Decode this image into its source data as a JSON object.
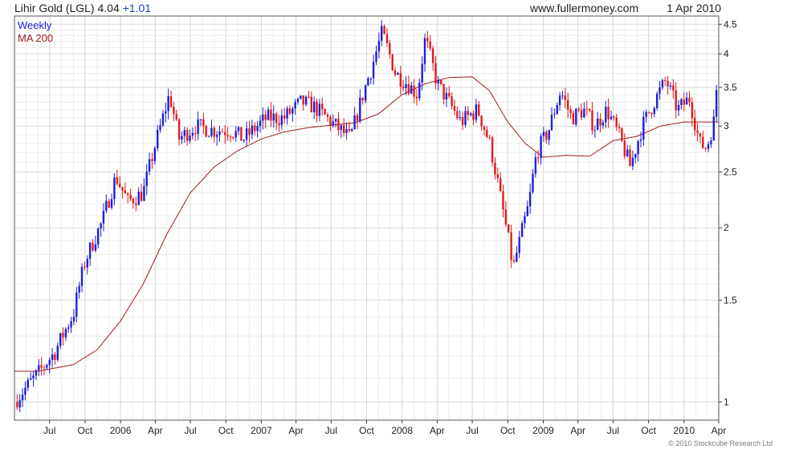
{
  "header": {
    "title": "Lihir Gold (LGL) 4.04",
    "change": "+1.01",
    "site": "www.fullermoney.com",
    "date": "1 Apr 2010"
  },
  "footer": {
    "credit": "© 2010 Stockcube Research Ltd"
  },
  "colors": {
    "up": "#1f1fd6",
    "down": "#e01b1b",
    "ma": "#a01c1c",
    "grid": "#d9d9d9",
    "legend_weekly": "#1f1fd6",
    "legend_ma": "#a01c1c"
  },
  "chart_data": {
    "type": "candlestick",
    "legend": [
      "Weekly",
      "MA 200"
    ],
    "x_axis": {
      "start": "2005-04-01",
      "end": "2010-04-01",
      "ticks": [
        {
          "label": "Jul",
          "date": "2005-07-01"
        },
        {
          "label": "Oct",
          "date": "2005-10-01"
        },
        {
          "label": "2006",
          "date": "2006-01-01"
        },
        {
          "label": "Apr",
          "date": "2006-04-01"
        },
        {
          "label": "Jul",
          "date": "2006-07-01"
        },
        {
          "label": "Oct",
          "date": "2006-10-01"
        },
        {
          "label": "2007",
          "date": "2007-01-01"
        },
        {
          "label": "Apr",
          "date": "2007-04-01"
        },
        {
          "label": "Jul",
          "date": "2007-07-01"
        },
        {
          "label": "Oct",
          "date": "2007-10-01"
        },
        {
          "label": "2008",
          "date": "2008-01-01"
        },
        {
          "label": "Apr",
          "date": "2008-04-01"
        },
        {
          "label": "Jul",
          "date": "2008-07-01"
        },
        {
          "label": "Oct",
          "date": "2008-10-01"
        },
        {
          "label": "2009",
          "date": "2009-01-01"
        },
        {
          "label": "Apr",
          "date": "2009-04-01"
        },
        {
          "label": "Jul",
          "date": "2009-07-01"
        },
        {
          "label": "Oct",
          "date": "2009-10-01"
        },
        {
          "label": "2010",
          "date": "2010-01-01"
        },
        {
          "label": "Apr",
          "date": "2010-04-01"
        }
      ]
    },
    "y_axis": {
      "scale": "log",
      "range": [
        0.93,
        4.65
      ],
      "ticks": [
        1,
        1.5,
        2,
        2.5,
        3,
        3.5,
        4,
        4.5
      ],
      "labels": [
        "1",
        "1.5",
        "2",
        "2.5",
        "3",
        "3.5",
        "4",
        "4.5"
      ],
      "minor_ticks": [
        1.1,
        1.2,
        1.3,
        1.4,
        1.6,
        1.7,
        1.8,
        1.9,
        2.1,
        2.2,
        2.3,
        2.4,
        2.6,
        2.7,
        2.8,
        2.9,
        3.1,
        3.2,
        3.3,
        3.4,
        3.6,
        3.7,
        3.8,
        3.9,
        4.1,
        4.2,
        4.3,
        4.4
      ]
    },
    "grid": true,
    "price_anchors": [
      [
        "2005-04-01",
        1.0
      ],
      [
        "2005-06-01",
        1.12
      ],
      [
        "2005-07-15",
        1.22
      ],
      [
        "2005-09-01",
        1.42
      ],
      [
        "2005-10-01",
        1.75
      ],
      [
        "2005-11-15",
        2.05
      ],
      [
        "2005-12-20",
        2.45
      ],
      [
        "2006-01-20",
        2.22
      ],
      [
        "2006-03-01",
        2.3
      ],
      [
        "2006-04-15",
        3.0
      ],
      [
        "2006-05-08",
        3.4
      ],
      [
        "2006-06-01",
        2.85
      ],
      [
        "2006-07-15",
        3.0
      ],
      [
        "2006-09-01",
        2.95
      ],
      [
        "2006-10-15",
        2.95
      ],
      [
        "2006-11-15",
        2.85
      ],
      [
        "2007-01-15",
        3.1
      ],
      [
        "2007-03-01",
        3.1
      ],
      [
        "2007-04-15",
        3.3
      ],
      [
        "2007-05-15",
        3.25
      ],
      [
        "2007-07-01",
        3.05
      ],
      [
        "2007-08-20",
        2.85
      ],
      [
        "2007-10-15",
        3.8
      ],
      [
        "2007-11-10",
        4.35
      ],
      [
        "2007-12-15",
        3.7
      ],
      [
        "2008-01-15",
        3.55
      ],
      [
        "2008-02-10",
        3.4
      ],
      [
        "2008-03-01",
        4.25
      ],
      [
        "2008-04-01",
        3.55
      ],
      [
        "2008-05-01",
        3.3
      ],
      [
        "2008-06-01",
        3.05
      ],
      [
        "2008-07-15",
        3.2
      ],
      [
        "2008-08-15",
        2.8
      ],
      [
        "2008-09-15",
        2.2
      ],
      [
        "2008-10-15",
        1.7
      ],
      [
        "2008-11-01",
        1.9
      ],
      [
        "2008-11-25",
        2.2
      ],
      [
        "2008-12-15",
        2.7
      ],
      [
        "2009-01-15",
        2.95
      ],
      [
        "2009-02-15",
        3.45
      ],
      [
        "2009-03-15",
        3.1
      ],
      [
        "2009-04-15",
        3.2
      ],
      [
        "2009-05-15",
        3.0
      ],
      [
        "2009-06-15",
        3.2
      ],
      [
        "2009-07-15",
        2.9
      ],
      [
        "2009-08-15",
        2.55
      ],
      [
        "2009-09-15",
        3.0
      ],
      [
        "2009-10-15",
        3.3
      ],
      [
        "2009-11-15",
        3.6
      ],
      [
        "2009-12-15",
        3.2
      ],
      [
        "2010-01-15",
        3.35
      ],
      [
        "2010-02-10",
        2.8
      ],
      [
        "2010-03-01",
        2.75
      ],
      [
        "2010-03-22",
        3.1
      ],
      [
        "2010-04-01",
        4.04
      ]
    ],
    "ma200": [
      [
        "2005-04-01",
        1.13
      ],
      [
        "2005-06-01",
        1.13
      ],
      [
        "2005-09-01",
        1.16
      ],
      [
        "2005-11-01",
        1.23
      ],
      [
        "2006-01-01",
        1.38
      ],
      [
        "2006-03-01",
        1.6
      ],
      [
        "2006-05-01",
        1.95
      ],
      [
        "2006-07-01",
        2.3
      ],
      [
        "2006-09-01",
        2.55
      ],
      [
        "2006-11-01",
        2.72
      ],
      [
        "2007-01-01",
        2.85
      ],
      [
        "2007-03-01",
        2.93
      ],
      [
        "2007-05-01",
        2.98
      ],
      [
        "2007-07-01",
        3.01
      ],
      [
        "2007-09-01",
        3.04
      ],
      [
        "2007-11-01",
        3.15
      ],
      [
        "2008-01-01",
        3.4
      ],
      [
        "2008-03-01",
        3.55
      ],
      [
        "2008-05-01",
        3.64
      ],
      [
        "2008-07-01",
        3.65
      ],
      [
        "2008-08-15",
        3.45
      ],
      [
        "2008-10-01",
        3.05
      ],
      [
        "2008-11-15",
        2.8
      ],
      [
        "2009-01-01",
        2.65
      ],
      [
        "2009-03-01",
        2.67
      ],
      [
        "2009-05-01",
        2.66
      ],
      [
        "2009-07-01",
        2.83
      ],
      [
        "2009-09-01",
        2.88
      ],
      [
        "2009-11-01",
        3.0
      ],
      [
        "2010-01-01",
        3.05
      ],
      [
        "2010-03-01",
        3.05
      ],
      [
        "2010-04-01",
        3.05
      ]
    ]
  }
}
